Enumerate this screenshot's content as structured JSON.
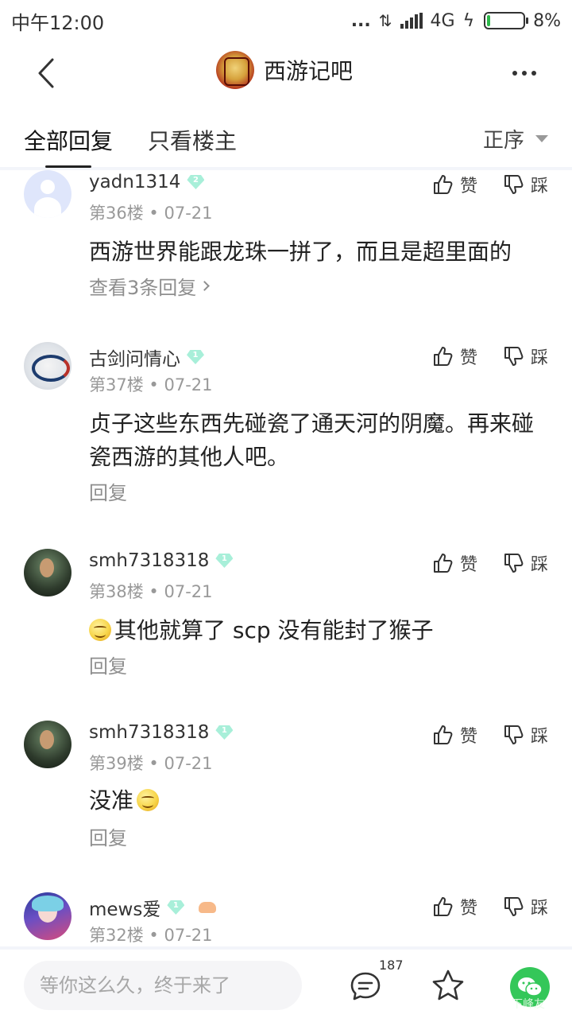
{
  "status_bar": {
    "time": "中午12:00",
    "dots": "...",
    "network": "4G",
    "battery": "8%"
  },
  "nav": {
    "forum_name": "西游记吧"
  },
  "tabs": {
    "all": "全部回复",
    "owner_only": "只看楼主",
    "sort": "正序"
  },
  "vote_labels": {
    "like": "赞",
    "dislike": "踩"
  },
  "posts": [
    {
      "username": "yadn1314",
      "level": "2",
      "floor": "第36楼",
      "date": "07-21",
      "content": "西游世界能跟龙珠一拼了，而且是超里面的",
      "reply_link": "查看3条回复"
    },
    {
      "username": "古剑问情心",
      "level": "1",
      "floor": "第37楼",
      "date": "07-21",
      "content": "贞子这些东西先碰瓷了通天河的阴魔。再来碰瓷西游的其他人吧。",
      "reply_link": "回复"
    },
    {
      "username": "smh7318318",
      "level": "1",
      "floor": "第38楼",
      "date": "07-21",
      "content": "其他就算了 scp 没有能封了猴子",
      "reply_link": "回复"
    },
    {
      "username": "smh7318318",
      "level": "1",
      "floor": "第39楼",
      "date": "07-21",
      "content": "没准",
      "reply_link": "回复"
    },
    {
      "username": "mews爱",
      "level": "1",
      "floor": "第32楼",
      "date": "07-21",
      "content": "",
      "reply_link": ""
    }
  ],
  "bottom_bar": {
    "input_placeholder": "等你这么久，终于来了",
    "comment_count": "187",
    "watermark": "下峰友"
  },
  "colors": {
    "level_badge": "#a8efd9",
    "wechat_green": "#34c759",
    "meta_gray": "#999999"
  }
}
